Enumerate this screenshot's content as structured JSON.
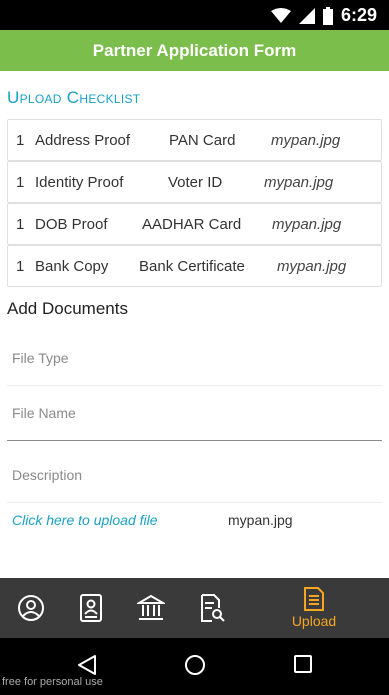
{
  "status": {
    "time": "6:29"
  },
  "appbar": {
    "title": "Partner Application Form"
  },
  "checklist": {
    "title": "Upload Checklist",
    "rows": [
      {
        "num": "1",
        "proof": "Address Proof",
        "doc": "PAN Card",
        "file": "mypan.jpg"
      },
      {
        "num": "1",
        "proof": "Identity Proof",
        "doc": "Voter ID",
        "file": "mypan.jpg"
      },
      {
        "num": "1",
        "proof": "DOB Proof",
        "doc": "AADHAR Card",
        "file": "mypan.jpg"
      },
      {
        "num": "1",
        "proof": "Bank Copy",
        "doc": "Bank Certificate",
        "file": "mypan.jpg"
      }
    ]
  },
  "add_documents": {
    "title": "Add Documents",
    "file_type_placeholder": "File Type",
    "file_name_placeholder": "File Name",
    "description_placeholder": "Description",
    "upload_link": "Click here to upload file",
    "uploaded_file": "mypan.jpg"
  },
  "bottom_nav": {
    "items": [
      {
        "icon": "profile-icon"
      },
      {
        "icon": "id-card-icon"
      },
      {
        "icon": "bank-icon"
      },
      {
        "icon": "document-search-icon"
      },
      {
        "icon": "upload-document-icon",
        "label": "Upload",
        "active": true
      }
    ],
    "active_color": "#f6a623"
  },
  "watermark": "free for personal use",
  "colors": {
    "appbar": "#7cbe4b",
    "accent": "#1aa1c5"
  }
}
